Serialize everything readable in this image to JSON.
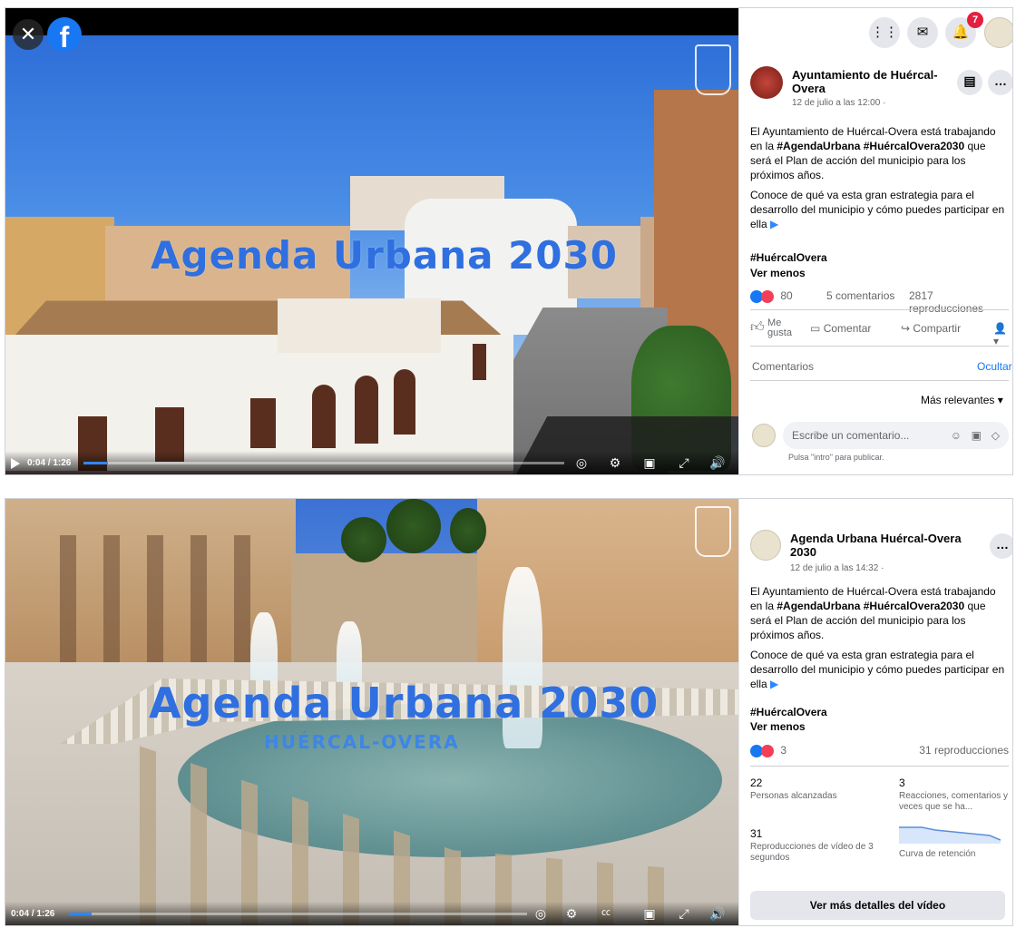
{
  "colors": {
    "fb_blue": "#1877f2",
    "overlay_title": "#2f6fe0",
    "progress": "#2d88ff",
    "badge": "#e41e3f"
  },
  "post1": {
    "video": {
      "overlay_title": "Agenda Urbana 2030",
      "time": "0:04 / 1:26",
      "progress": 0.05
    },
    "topbar": {
      "notifications_count": "7"
    },
    "author": "Ayuntamiento de Huércal-Overa",
    "timestamp": "12 de julio a las 12:00 ·",
    "text_1_pre": "El Ayuntamiento de Huércal-Overa está trabajando en la ",
    "hashtag_1": "#AgendaUrbana",
    "hashtag_2": "#HuércalOvera2030",
    "text_1_post": " que será el Plan de acción del municipio para los próximos años.",
    "text_2": "Conoce de qué va esta gran estrategia para el desarrollo del municipio y cómo puedes participar en ella",
    "hashtag_3": "#HuércalOvera",
    "see_less": "Ver menos",
    "reactions_count": "80",
    "comments_count": "5 comentarios",
    "views": "2817 reproducciones",
    "like_label_1": "Me",
    "like_label_2": "gusta",
    "comment_label": "Comentar",
    "share_label": "Compartir",
    "comments_header": "Comentarios",
    "hide_label": "Ocultar",
    "sort_label": "Más relevantes",
    "comment_placeholder": "Escribe un comentario...",
    "enter_hint": "Pulsa \"intro\" para publicar."
  },
  "post2": {
    "video": {
      "overlay_title": "Agenda Urbana 2030",
      "overlay_subtitle": "HUÉRCAL-OVERA",
      "time": "0:04 / 1:26",
      "progress": 0.05
    },
    "author": "Agenda Urbana Huércal-Overa 2030",
    "timestamp": "12 de julio a las 14:32 ·",
    "text_1_pre": "El Ayuntamiento de Huércal-Overa está trabajando en la ",
    "hashtag_1": "#AgendaUrbana",
    "hashtag_2": "#HuércalOvera2030",
    "text_1_post": " que será el Plan de acción del municipio para los próximos años.",
    "text_2": "Conoce de qué va esta gran estrategia para el desarrollo del municipio y cómo puedes participar en ella",
    "hashtag_3": "#HuércalOvera",
    "see_less": "Ver menos",
    "reactions_count": "3",
    "views": "31 reproducciones",
    "stats": {
      "reached_value": "22",
      "reached_label": "Personas alcanzadas",
      "reactions_value": "3",
      "reactions_label": "Reacciones, comentarios y veces que se ha...",
      "plays_value": "31",
      "plays_label": "Reproducciones de vídeo de 3 segundos",
      "retention_label": "Curva de retención"
    },
    "details_button": "Ver más detalles del vídeo"
  }
}
